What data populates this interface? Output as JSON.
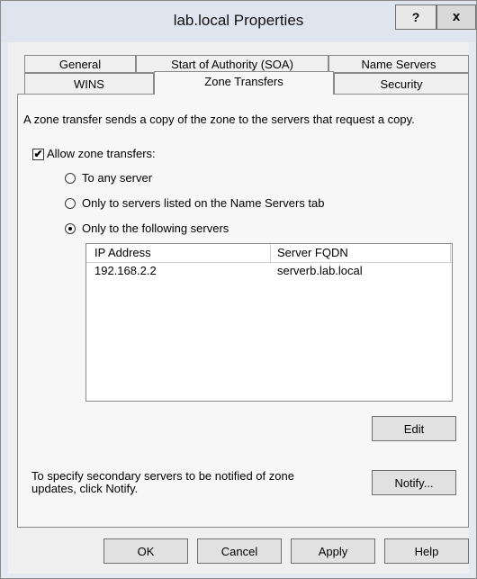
{
  "window": {
    "title": "lab.local Properties",
    "help_label": "?",
    "close_label": "x"
  },
  "tabs": {
    "row1": [
      {
        "label": "General"
      },
      {
        "label": "Start of Authority (SOA)"
      },
      {
        "label": "Name Servers"
      }
    ],
    "row2": [
      {
        "label": "WINS"
      },
      {
        "label": "Zone Transfers"
      },
      {
        "label": "Security"
      }
    ],
    "active": "Zone Transfers"
  },
  "zone_transfers": {
    "description": "A zone transfer sends a copy of the zone to the servers that request a copy.",
    "allow_label": "Allow zone transfers:",
    "allow_checked": true,
    "options": [
      {
        "label": "To any server",
        "selected": false
      },
      {
        "label": "Only to servers listed on the Name Servers tab",
        "selected": false
      },
      {
        "label": "Only to the following servers",
        "selected": true
      }
    ],
    "columns": [
      "IP Address",
      "Server FQDN"
    ],
    "rows": [
      {
        "ip": "192.168.2.2",
        "fqdn": "serverb.lab.local"
      }
    ],
    "edit_label": "Edit",
    "notify_text_line1": "To specify secondary servers to be notified of zone",
    "notify_text_line2": "updates, click Notify.",
    "notify_label": "Notify..."
  },
  "footer": {
    "ok_label": "OK",
    "cancel_label": "Cancel",
    "apply_label": "Apply",
    "help_label": "Help"
  }
}
